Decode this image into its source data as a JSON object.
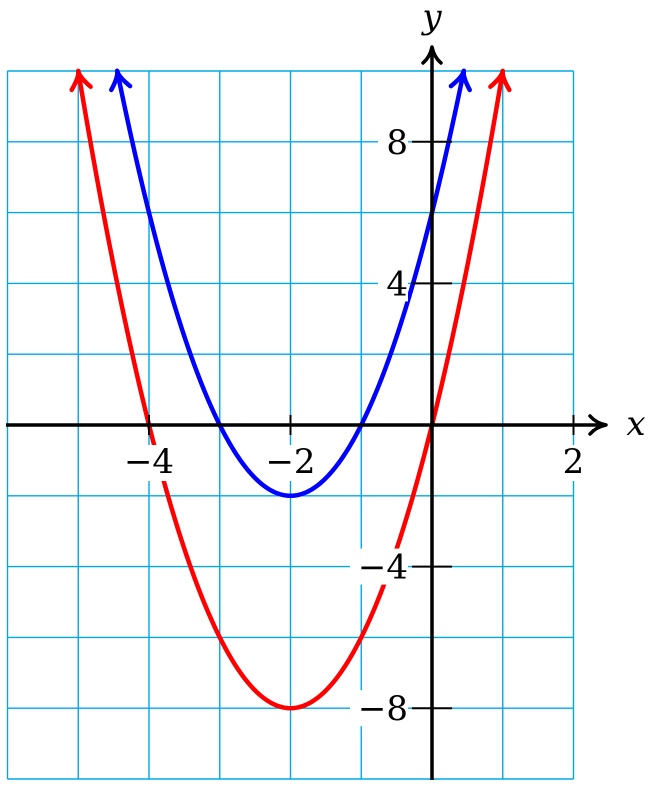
{
  "chart_data": {
    "type": "line",
    "title": "",
    "xlabel": "x",
    "ylabel": "y",
    "xlim": [
      -6,
      2
    ],
    "ylim": [
      -10,
      10
    ],
    "grid": true,
    "x_gridlines": [
      -6,
      -5,
      -4,
      -3,
      -2,
      -1,
      0,
      1,
      2
    ],
    "y_gridlines": [
      -10,
      -8,
      -6,
      -4,
      -2,
      0,
      2,
      4,
      6,
      8,
      10
    ],
    "x_ticks": [
      {
        "value": -4,
        "label": "−4"
      },
      {
        "value": -2,
        "label": "−2"
      },
      {
        "value": 2,
        "label": "2"
      }
    ],
    "y_ticks": [
      {
        "value": 8,
        "label": "8"
      },
      {
        "value": 4,
        "label": "4"
      },
      {
        "value": -4,
        "label": "−4"
      },
      {
        "value": -8,
        "label": "−8"
      }
    ],
    "series": [
      {
        "formula": "y = 2(x+2)^2 - 8",
        "color": "#ff0000",
        "x": [
          -5,
          -4.5,
          -4,
          -3.5,
          -3,
          -2.5,
          -2,
          -1.5,
          -1,
          -0.5,
          0,
          0.5,
          1
        ],
        "values": [
          10,
          4.5,
          0,
          -3.5,
          -6,
          -7.5,
          -8,
          -7.5,
          -6,
          -3.5,
          0,
          4.5,
          10
        ]
      },
      {
        "formula": "y = 2(x+2)^2 - 2",
        "color": "#0000ff",
        "x": [
          -4.45,
          -4,
          -3.5,
          -3,
          -2.5,
          -2,
          -1.5,
          -1,
          -0.5,
          0,
          0.45
        ],
        "values": [
          10,
          6,
          2.5,
          0,
          -1.5,
          -2,
          -1.5,
          0,
          2.5,
          6,
          10
        ]
      }
    ],
    "colors": {
      "grid": "#00a8e8",
      "axis": "#000000"
    }
  }
}
